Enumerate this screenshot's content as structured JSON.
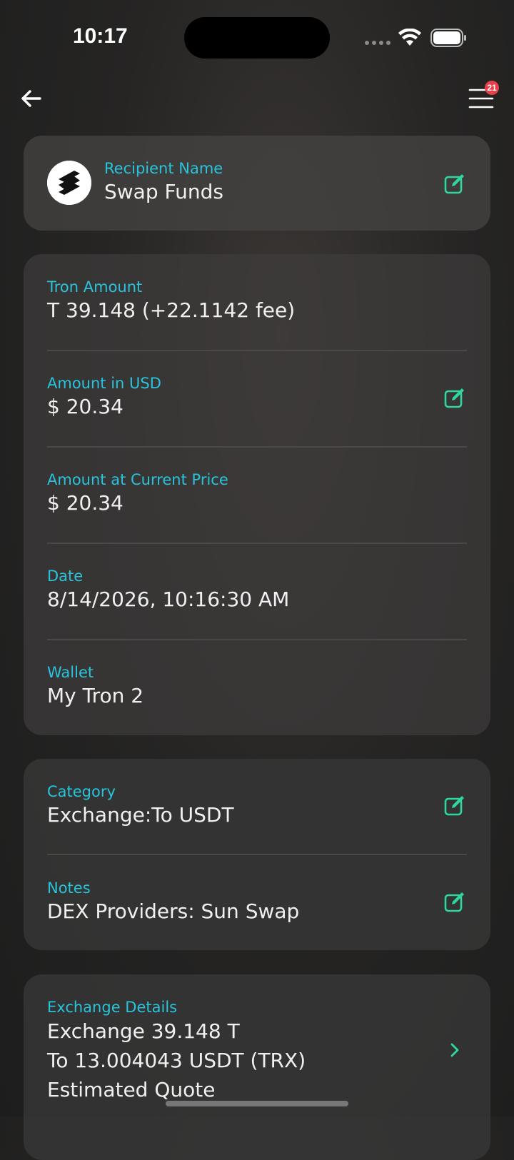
{
  "status": {
    "time": "10:17"
  },
  "header": {
    "badge_count": "21"
  },
  "recipient": {
    "label": "Recipient Name",
    "value": "Swap Funds"
  },
  "details": [
    {
      "label": "Tron Amount",
      "value": "T 39.148 (+22.1142 fee)"
    },
    {
      "label": "Amount in USD",
      "value": "$ 20.34"
    },
    {
      "label": "Amount at Current Price",
      "value": "$ 20.34"
    },
    {
      "label": "Date",
      "value": "8/14/2026, 10:16:30 AM"
    },
    {
      "label": "Wallet",
      "value": "My Tron 2"
    }
  ],
  "category": {
    "label": "Category",
    "value": "Exchange:To USDT"
  },
  "notes": {
    "label": "Notes",
    "value": "DEX Providers: Sun Swap"
  },
  "exchange": {
    "label": "Exchange Details",
    "line1": "Exchange 39.148 T",
    "line2": "To 13.004043 USDT (TRX)",
    "line3": "Estimated Quote"
  },
  "colors": {
    "accent_label": "#28c4dc",
    "edit_icon": "#2fd6a0",
    "badge": "#e8404a"
  }
}
